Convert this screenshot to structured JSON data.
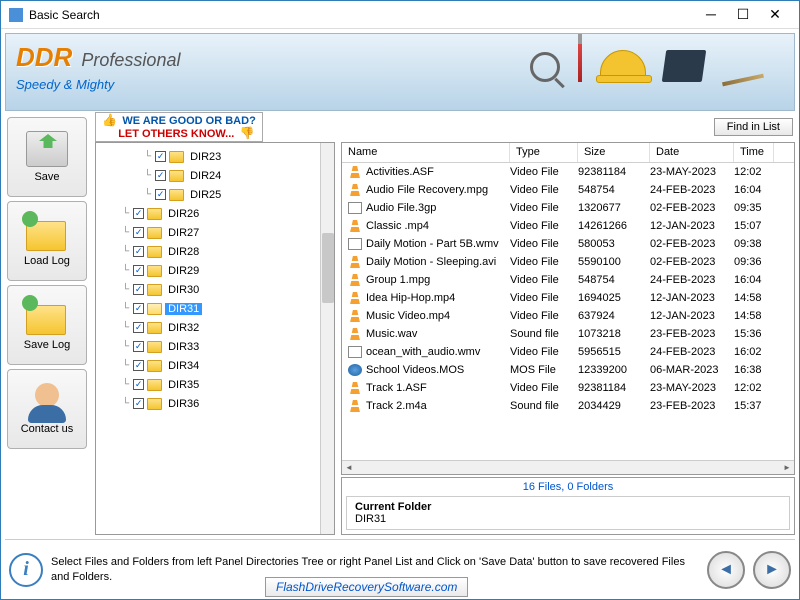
{
  "window": {
    "title": "Basic Search"
  },
  "banner": {
    "logo1": "DDR",
    "logo2": "Professional",
    "tagline": "Speedy & Mighty"
  },
  "feedback": {
    "line1": "WE ARE GOOD OR BAD?",
    "line2": "LET OTHERS KNOW..."
  },
  "find_btn": "Find in List",
  "sidebar": [
    {
      "label": "Save"
    },
    {
      "label": "Load Log"
    },
    {
      "label": "Save Log"
    },
    {
      "label": "Contact us"
    }
  ],
  "tree": {
    "selected": "DIR31",
    "items": [
      {
        "label": "DIR23",
        "sub": true
      },
      {
        "label": "DIR24",
        "sub": true
      },
      {
        "label": "DIR25",
        "sub": true
      },
      {
        "label": "DIR26",
        "sub": false
      },
      {
        "label": "DIR27",
        "sub": false
      },
      {
        "label": "DIR28",
        "sub": false
      },
      {
        "label": "DIR29",
        "sub": false
      },
      {
        "label": "DIR30",
        "sub": false
      },
      {
        "label": "DIR31",
        "sub": false,
        "open": true,
        "sel": true
      },
      {
        "label": "DIR32",
        "sub": false
      },
      {
        "label": "DIR33",
        "sub": false
      },
      {
        "label": "DIR34",
        "sub": false
      },
      {
        "label": "DIR35",
        "sub": false
      },
      {
        "label": "DIR36",
        "sub": false
      }
    ]
  },
  "table": {
    "headers": {
      "name": "Name",
      "type": "Type",
      "size": "Size",
      "date": "Date",
      "time": "Time"
    },
    "rows": [
      {
        "ic": "vlc",
        "name": "Activities.ASF",
        "type": "Video File",
        "size": "92381184",
        "date": "23-MAY-2023",
        "time": "12:02"
      },
      {
        "ic": "vlc",
        "name": "Audio File Recovery.mpg",
        "type": "Video File",
        "size": "548754",
        "date": "24-FEB-2023",
        "time": "16:04"
      },
      {
        "ic": "doc",
        "name": "Audio File.3gp",
        "type": "Video File",
        "size": "1320677",
        "date": "02-FEB-2023",
        "time": "09:35"
      },
      {
        "ic": "vlc",
        "name": "Classic .mp4",
        "type": "Video File",
        "size": "14261266",
        "date": "12-JAN-2023",
        "time": "15:07"
      },
      {
        "ic": "doc",
        "name": "Daily Motion - Part 5B.wmv",
        "type": "Video File",
        "size": "580053",
        "date": "02-FEB-2023",
        "time": "09:38"
      },
      {
        "ic": "vlc",
        "name": "Daily Motion - Sleeping.avi",
        "type": "Video File",
        "size": "5590100",
        "date": "02-FEB-2023",
        "time": "09:36"
      },
      {
        "ic": "vlc",
        "name": "Group 1.mpg",
        "type": "Video File",
        "size": "548754",
        "date": "24-FEB-2023",
        "time": "16:04"
      },
      {
        "ic": "vlc",
        "name": "Idea Hip-Hop.mp4",
        "type": "Video File",
        "size": "1694025",
        "date": "12-JAN-2023",
        "time": "14:58"
      },
      {
        "ic": "vlc",
        "name": "Music Video.mp4",
        "type": "Video File",
        "size": "637924",
        "date": "12-JAN-2023",
        "time": "14:58"
      },
      {
        "ic": "vlc",
        "name": "Music.wav",
        "type": "Sound file",
        "size": "1073218",
        "date": "23-FEB-2023",
        "time": "15:36"
      },
      {
        "ic": "doc",
        "name": "ocean_with_audio.wmv",
        "type": "Video File",
        "size": "5956515",
        "date": "24-FEB-2023",
        "time": "16:02"
      },
      {
        "ic": "wmp",
        "name": "School Videos.MOS",
        "type": "MOS File",
        "size": "12339200",
        "date": "06-MAR-2023",
        "time": "16:38"
      },
      {
        "ic": "vlc",
        "name": "Track 1.ASF",
        "type": "Video File",
        "size": "92381184",
        "date": "23-MAY-2023",
        "time": "12:02"
      },
      {
        "ic": "vlc",
        "name": "Track 2.m4a",
        "type": "Sound file",
        "size": "2034429",
        "date": "23-FEB-2023",
        "time": "15:37"
      }
    ]
  },
  "status": {
    "count": "16 Files, 0 Folders",
    "cur_label": "Current Folder",
    "cur_val": "DIR31"
  },
  "footer": {
    "tip": "Select Files and Folders from left Panel Directories Tree or right Panel List and Click on 'Save Data' button to save recovered Files and Folders.",
    "link": "FlashDriveRecoverySoftware.com"
  }
}
